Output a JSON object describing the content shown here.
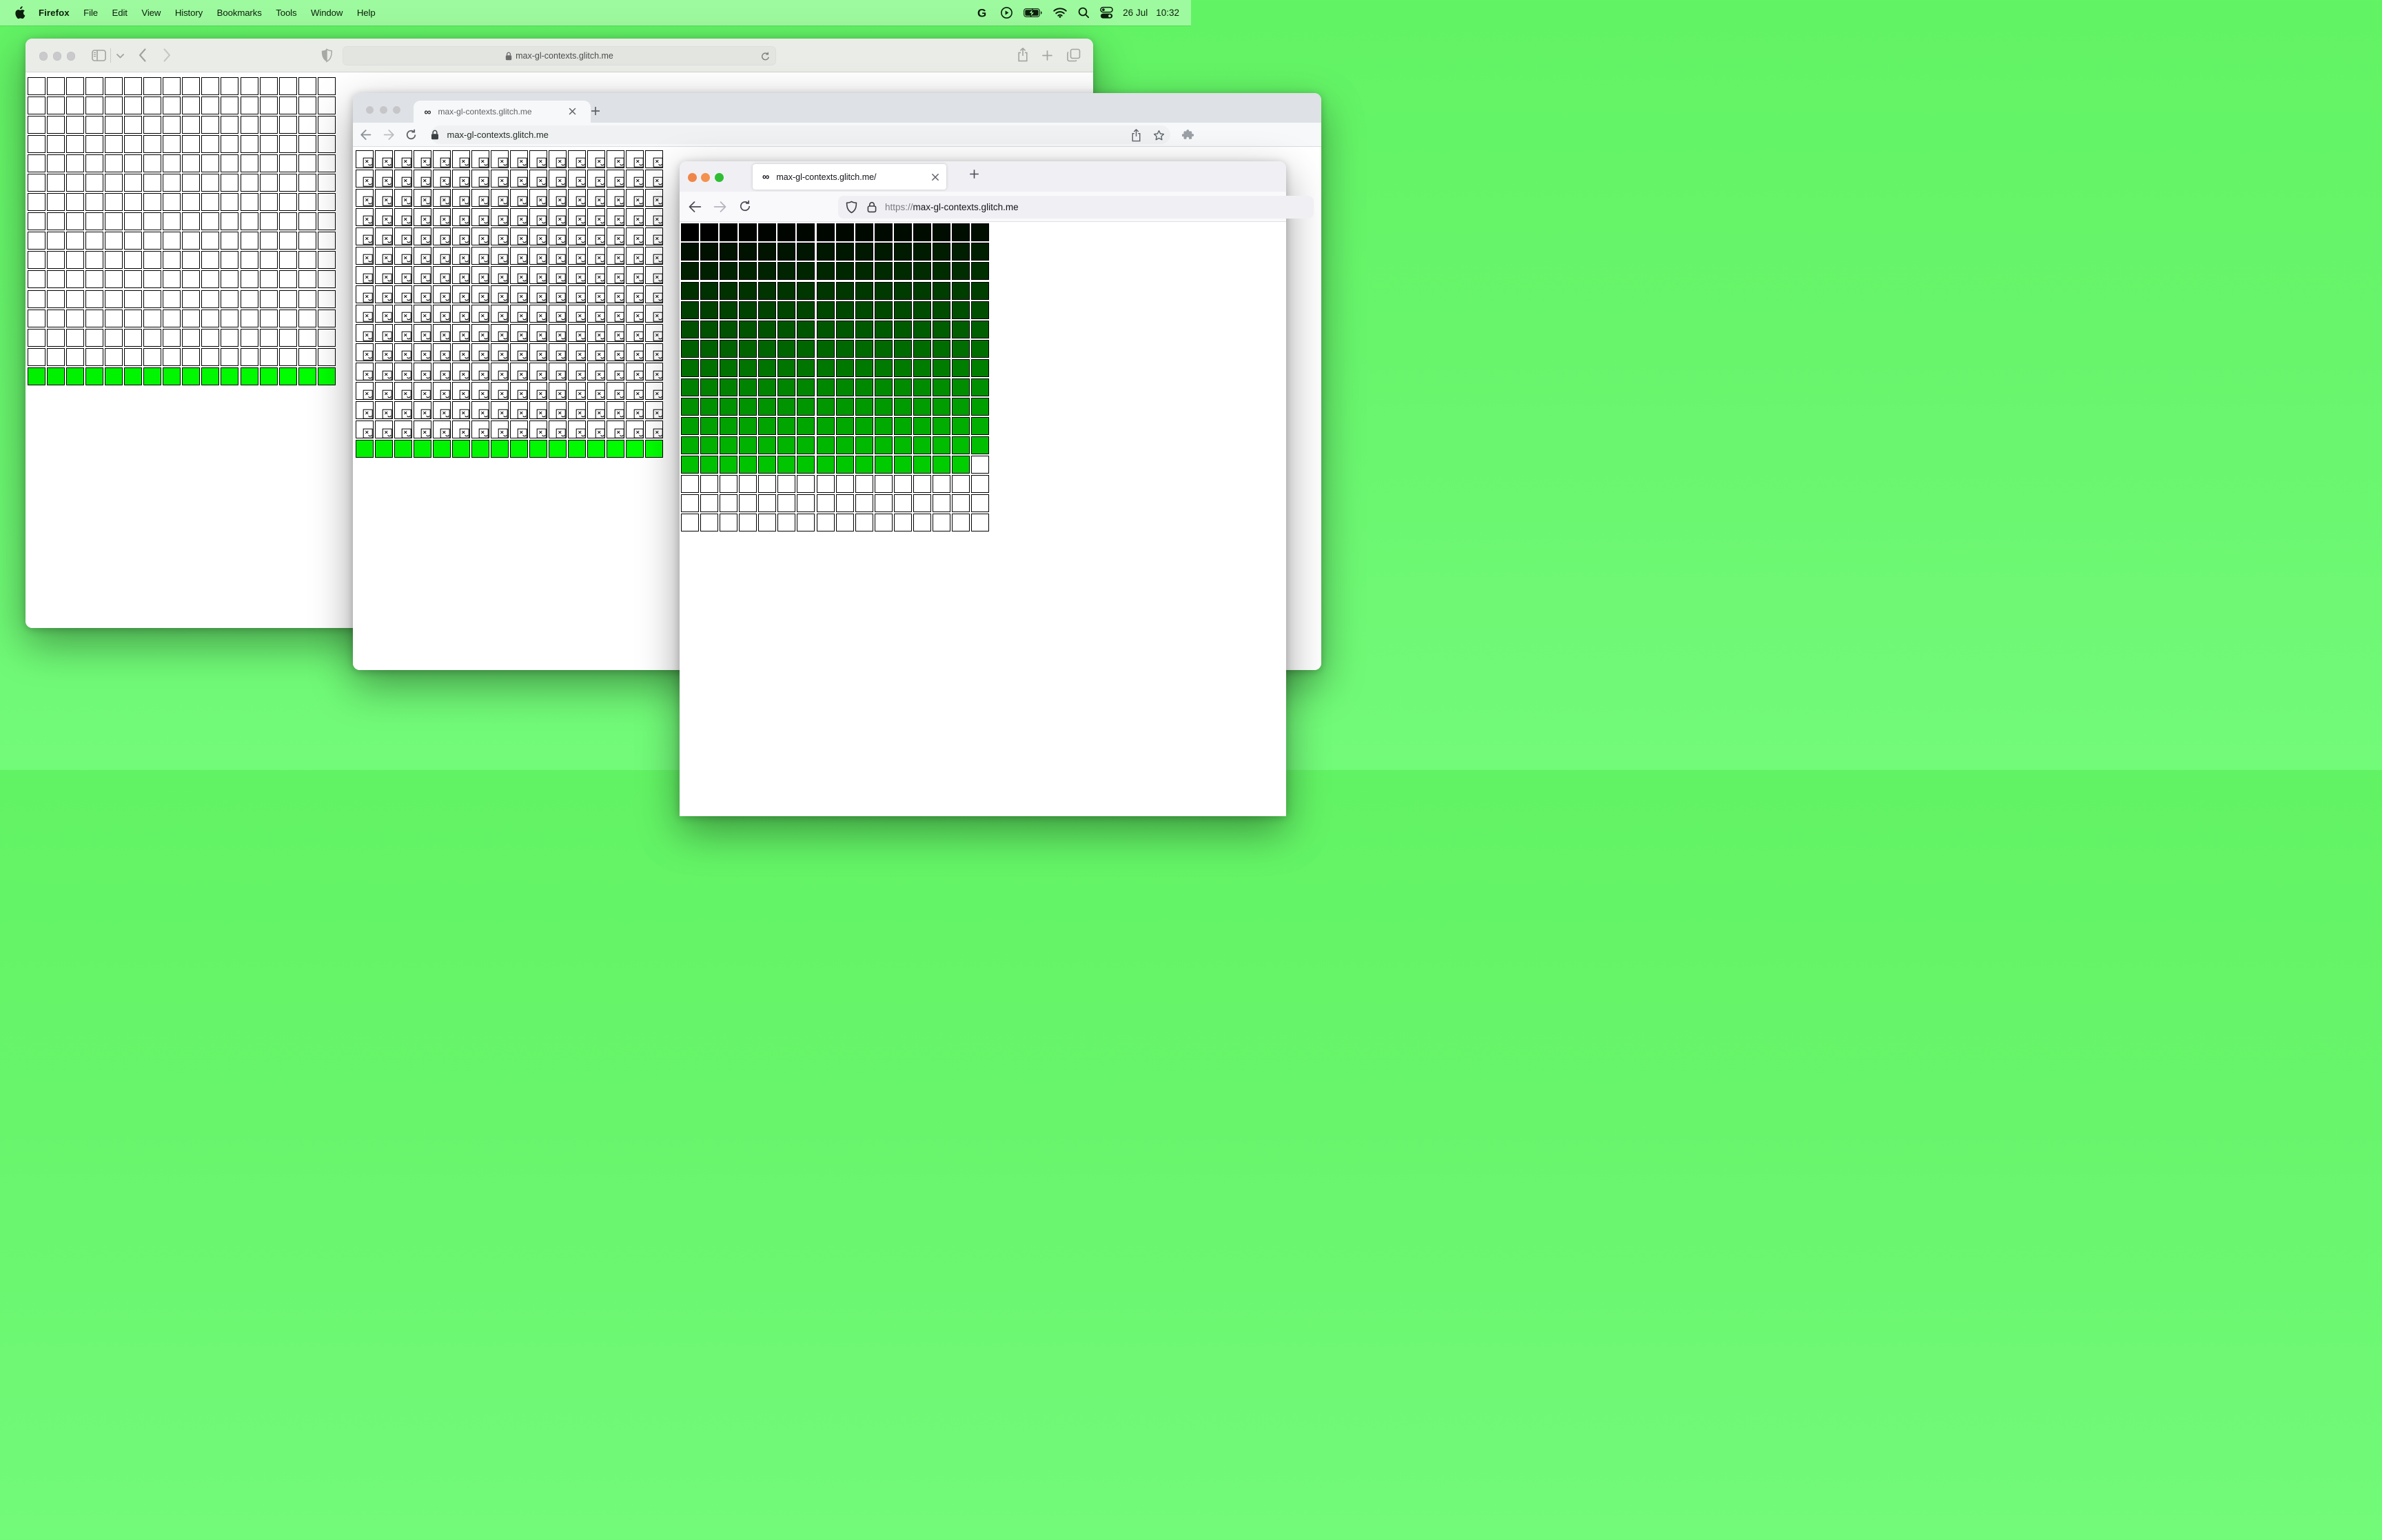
{
  "site_host": "max-gl-contexts.glitch.me",
  "menu_bar": {
    "app_name": "Firefox",
    "menus": [
      "File",
      "Edit",
      "View",
      "History",
      "Bookmarks",
      "Tools",
      "Window",
      "Help"
    ],
    "status_icons": [
      "google-g",
      "play-circle",
      "battery-charging",
      "wifi",
      "spotlight-search",
      "control-center"
    ],
    "date": "26 Jul",
    "time": "10:32"
  },
  "colors": {
    "desktop_green": "#5bef5b",
    "menubar_green": "#a4f7a2",
    "context_alive_green": "#00ff00",
    "firefox_traffic_close": "#f0854a",
    "firefox_traffic_min": "#f4914e",
    "firefox_traffic_zoom": "#2fbe33",
    "inactive_traffic_gray": "#cacacd"
  },
  "safari_window": {
    "url_text": "max-gl-contexts.glitch.me",
    "grid": {
      "columns": 16,
      "rows": 16,
      "total": 256,
      "segments": [
        {
          "count": 240,
          "state": "context-lost-blank"
        },
        {
          "count": 16,
          "state": "context-alive"
        }
      ],
      "alive_color_rule": "rgb(0,index,0)"
    }
  },
  "chrome_window": {
    "favicon": "∞",
    "tab_title": "max-gl-contexts.glitch.me",
    "url_text": "max-gl-contexts.glitch.me",
    "grid": {
      "columns": 16,
      "rows": 16,
      "total": 256,
      "segments": [
        {
          "count": 240,
          "state": "context-lost-sad-icon"
        },
        {
          "count": 16,
          "state": "context-alive"
        }
      ],
      "alive_color_rule": "rgb(0,index,0)"
    }
  },
  "firefox_window": {
    "favicon": "∞",
    "tab_title": "max-gl-contexts.glitch.me/",
    "url_scheme": "https://",
    "url_host": "max-gl-contexts.glitch.me",
    "grid": {
      "columns": 16,
      "rows": 16,
      "total": 256,
      "segments": [
        {
          "count": 207,
          "state": "context-alive"
        },
        {
          "count": 49,
          "state": "context-lost-blank"
        }
      ],
      "alive_color_rule": "rgb(0,index,0)"
    }
  }
}
